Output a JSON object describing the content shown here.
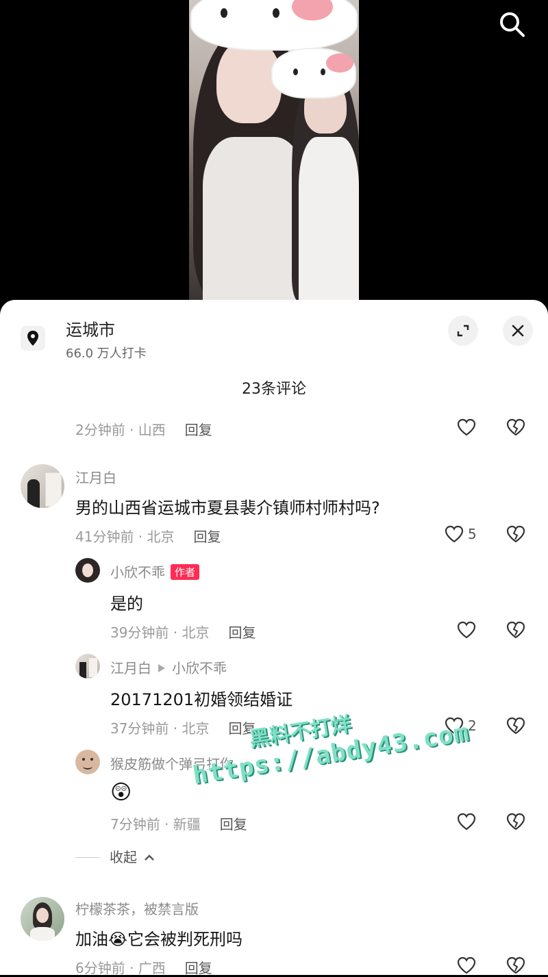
{
  "location": {
    "title": "运城市",
    "subtitle": "66.0 万人打卡"
  },
  "comment_count": "23条评论",
  "comments": [
    {
      "meta_time": "2分钟前 · 山西",
      "reply": "回复"
    },
    {
      "name": "江月白",
      "text": "男的山西省运城市夏县裴介镇师村师村吗?",
      "meta_time": "41分钟前 · 北京",
      "reply": "回复",
      "likes": "5",
      "replies": [
        {
          "name": "小欣不乖",
          "badge": "作者",
          "text": "是的",
          "meta_time": "39分钟前 · 北京",
          "reply": "回复"
        },
        {
          "name": "江月白",
          "reply_to": "小欣不乖",
          "text": "20171201初婚领结婚证",
          "meta_time": "37分钟前 · 北京",
          "reply": "回复",
          "likes": "2"
        },
        {
          "name": "猴皮筋做个弹弓打你",
          "text": "😲",
          "meta_time": "7分钟前 · 新疆",
          "reply": "回复"
        }
      ]
    },
    {
      "name": "柠檬茶茶，被禁言版",
      "text": "加油😭它会被判死刑吗",
      "meta_time": "6分钟前 · 广西",
      "reply": "回复"
    }
  ],
  "collapse_label": "收起",
  "watermark": {
    "line1": "黑料不打烊",
    "line2": "https://abdy43.com"
  },
  "colors": {
    "accent": "#fe2c55",
    "watermark": "#7fe0c6"
  }
}
